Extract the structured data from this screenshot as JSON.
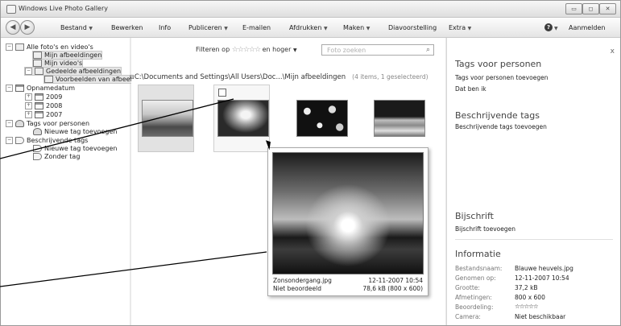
{
  "window": {
    "title": "Windows Live Photo Gallery"
  },
  "window_controls": {
    "minimize": "▭",
    "maximize": "◻",
    "close": "✕"
  },
  "toolbar": {
    "back": "◀",
    "forward": "▶",
    "menus": [
      "Bestand",
      "Bewerken",
      "Info",
      "Publiceren",
      "E-mailen",
      "Afdrukken",
      "Maken",
      "Diavoorstelling",
      "Extra"
    ],
    "signin": "Aanmelden"
  },
  "tree": {
    "all": "Alle foto's en video's",
    "my_pictures": "Mijn afbeeldingen",
    "my_videos": "Mijn video's",
    "shared": "Gedeelde afbeeldingen",
    "samples": "Voorbeelden van afbeel",
    "date_taken": "Opnamedatum",
    "years": [
      "2009",
      "2008",
      "2007"
    ],
    "people_tags": "Tags voor personen",
    "new_person_tag": "Nieuwe tag toevoegen",
    "desc_tags": "Beschrijvende tags",
    "new_desc_tag": "Nieuwe tag toevoegen",
    "no_tag": "Zonder tag"
  },
  "filter": {
    "label": "Filteren op",
    "stars": "☆☆☆☆☆",
    "suffix": "en hoger",
    "search_placeholder": "Foto zoeken"
  },
  "path": {
    "text": "C:\\Documents  and  Settings\\All  Users\\Doc...\\Mijn  afbeeldingen",
    "count": "(4 items, 1 geselecteerd)"
  },
  "preview": {
    "filename": "Zonsondergang.jpg",
    "rating": "Niet beoordeeld",
    "date": "12-11-2007 10:54",
    "size": "78,6 kB (800 x 600)"
  },
  "panel": {
    "close": "x",
    "people_heading": "Tags voor personen",
    "people_add": "Tags voor personen toevoegen",
    "its_me": "Dat ben ik",
    "desc_heading": "Beschrijvende tags",
    "desc_add": "Beschrijvende tags toevoegen",
    "caption_heading": "Bijschrift",
    "caption_add": "Bijschrift toevoegen",
    "info_heading": "Informatie",
    "info": [
      {
        "key": "Bestandsnaam:",
        "value": "Blauwe heuvels.jpg"
      },
      {
        "key": "Genomen op:",
        "value": "12-11-2007 10:54"
      },
      {
        "key": "Grootte:",
        "value": "37,2 kB"
      },
      {
        "key": "Afmetingen:",
        "value": "800 x 600"
      },
      {
        "key": "Beoordeling:",
        "value": "☆☆☆☆☆"
      },
      {
        "key": "Camera:",
        "value": "Niet beschikbaar"
      }
    ]
  },
  "colors": {
    "window_bg": "#e9e9e9",
    "selection": "#e2e2e2",
    "text": "#222222"
  }
}
